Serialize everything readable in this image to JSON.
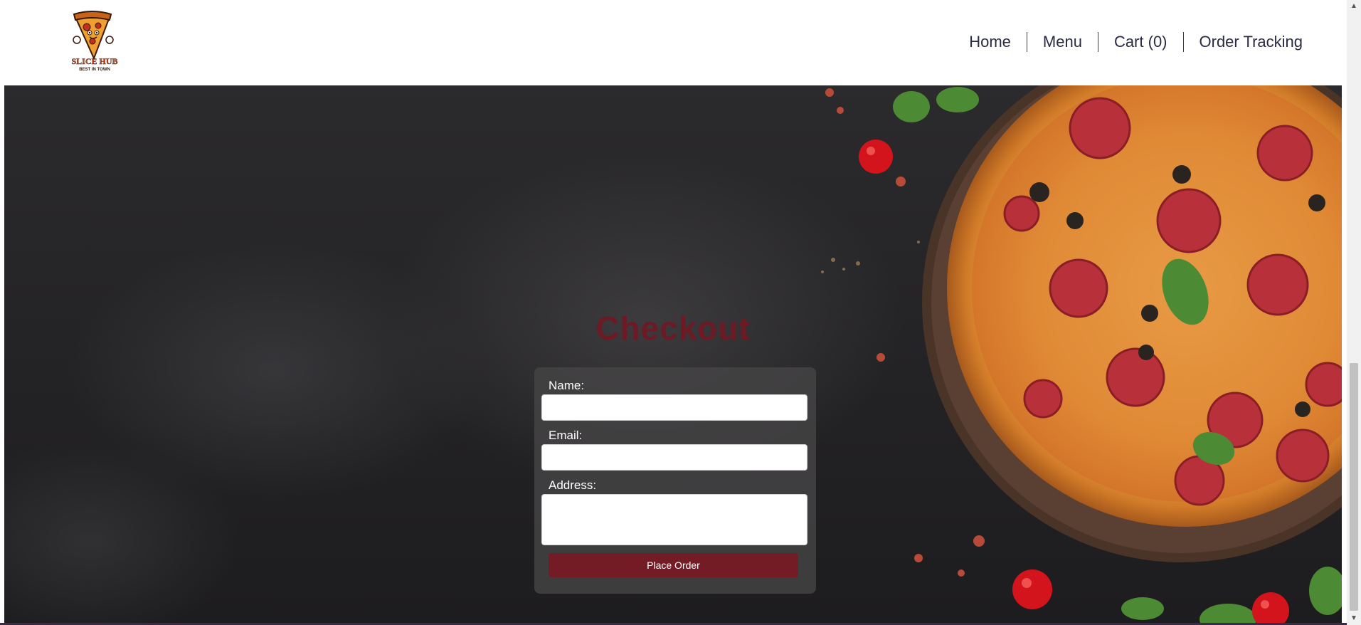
{
  "brand": {
    "name": "SLICE HUB",
    "tagline": "BEST IN TOWN"
  },
  "nav": {
    "items": [
      {
        "label": "Home"
      },
      {
        "label": "Menu"
      },
      {
        "label": "Cart (0)"
      },
      {
        "label": "Order Tracking"
      }
    ]
  },
  "checkout": {
    "title": "Checkout",
    "name_label": "Name:",
    "name_value": "",
    "email_label": "Email:",
    "email_value": "",
    "address_label": "Address:",
    "address_value": "",
    "submit_label": "Place Order"
  },
  "colors": {
    "accent": "#741c26",
    "nav_text": "#2a2a44",
    "hero_bg": "#232224"
  }
}
